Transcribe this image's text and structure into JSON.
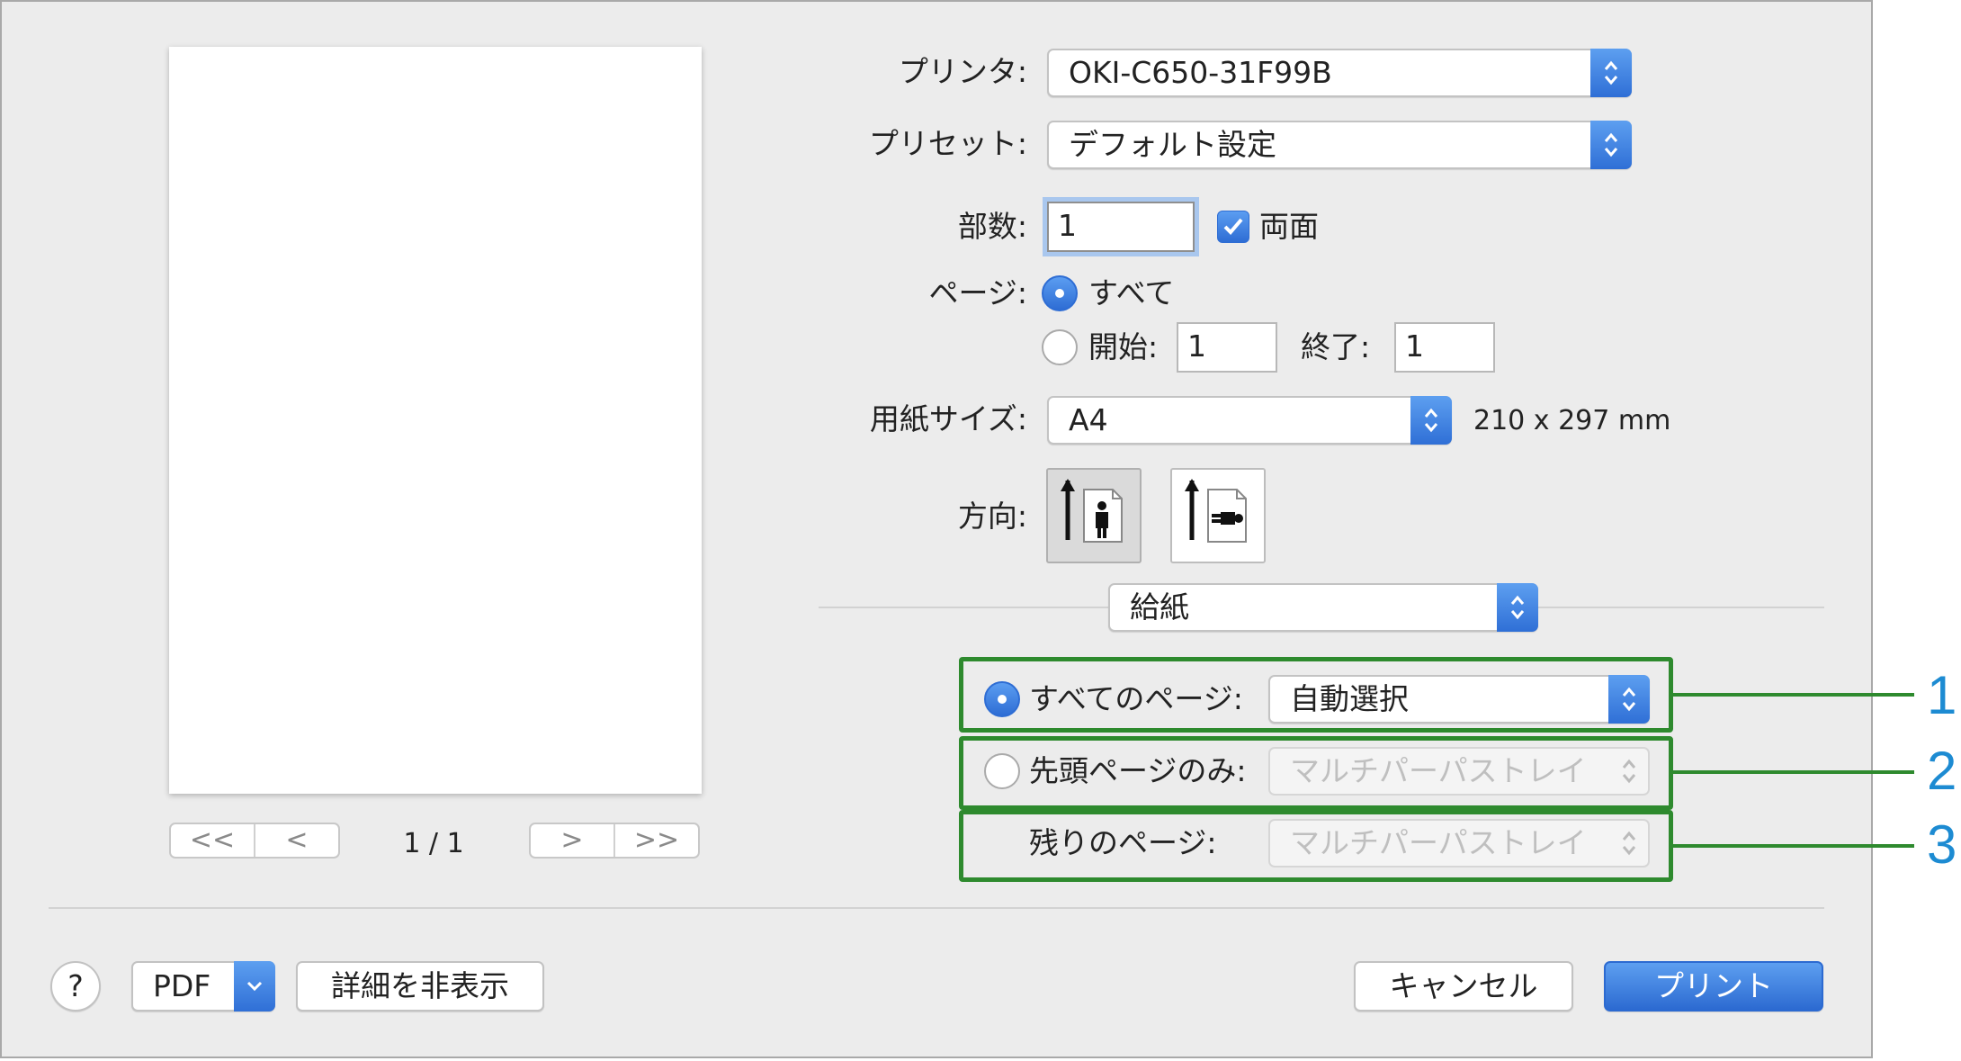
{
  "printer": {
    "label": "プリンタ:",
    "value": "OKI-C650-31F99B"
  },
  "preset": {
    "label": "プリセット:",
    "value": "デフォルト設定"
  },
  "copies": {
    "label": "部数:",
    "value": "1",
    "duplex_label": "両面",
    "duplex_checked": true
  },
  "pages": {
    "label": "ページ:",
    "all_label": "すべて",
    "from_label": "開始:",
    "from_value": "1",
    "to_label": "終了:",
    "to_value": "1"
  },
  "paper_size": {
    "label": "用紙サイズ:",
    "value": "A4",
    "dimensions": "210 x 297 mm"
  },
  "orientation": {
    "label": "方向:"
  },
  "panel_popup": {
    "value": "給紙"
  },
  "paper_feed": {
    "all_pages_label": "すべてのページ:",
    "all_pages_value": "自動選択",
    "first_page_label": "先頭ページのみ:",
    "first_page_value": "マルチパーパストレイ",
    "remaining_label": "残りのページ:",
    "remaining_value": "マルチパーパストレイ"
  },
  "callouts": [
    "1",
    "2",
    "3"
  ],
  "preview": {
    "page_indicator": "1 / 1",
    "nav": {
      "first": "<<",
      "prev": "<",
      "next": ">",
      "last": ">>"
    }
  },
  "footer": {
    "help": "?",
    "pdf": "PDF",
    "hide_details": "詳細を非表示",
    "cancel": "キャンセル",
    "print": "プリント"
  },
  "colors": {
    "accent": "#3a7be0",
    "callout_box": "#2e8a2e",
    "callout_number": "#1d8bd2"
  }
}
